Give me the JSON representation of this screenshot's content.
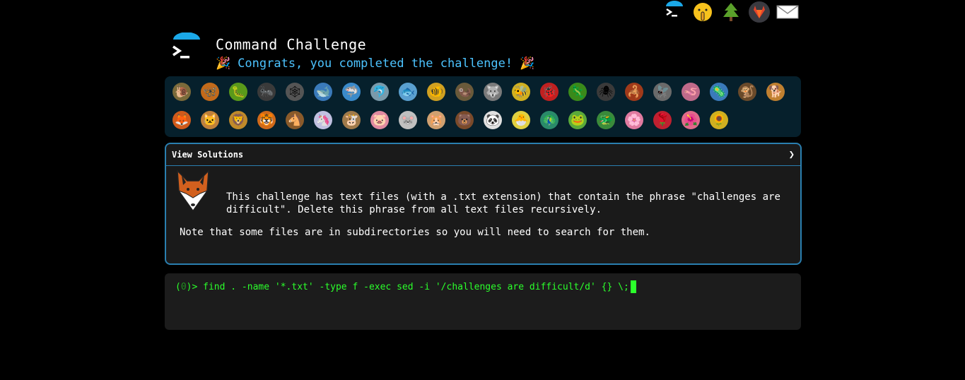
{
  "header": {
    "title": "Command Challenge",
    "subtitle": "Congrats, you completed the challenge!",
    "party_icon": "🎉"
  },
  "topnav": [
    {
      "name": "terminal-logo-icon"
    },
    {
      "name": "shush-face-icon",
      "glyph": "🤫"
    },
    {
      "name": "tree-icon",
      "glyph": "🌲"
    },
    {
      "name": "gitlab-icon"
    },
    {
      "name": "mail-icon",
      "glyph": "✉"
    }
  ],
  "challenges_row1": [
    {
      "name": "snail",
      "glyph": "🐌",
      "color": "#7a6a3a"
    },
    {
      "name": "butterfly",
      "glyph": "🦋",
      "color": "#c26a1a"
    },
    {
      "name": "caterpillar",
      "glyph": "🐛",
      "color": "#5a9a1a"
    },
    {
      "name": "ant",
      "glyph": "🐜",
      "color": "#3a3a3a"
    },
    {
      "name": "spider-web",
      "glyph": "🕸",
      "color": "#555"
    },
    {
      "name": "whale",
      "glyph": "🐋",
      "color": "#3a7aba"
    },
    {
      "name": "shark",
      "glyph": "🦈",
      "color": "#3a8aca"
    },
    {
      "name": "dolphin",
      "glyph": "🐬",
      "color": "#7a9aaa"
    },
    {
      "name": "fish",
      "glyph": "🐟",
      "color": "#5aa0d0"
    },
    {
      "name": "tropical-fish",
      "glyph": "🐠",
      "color": "#d0a020"
    },
    {
      "name": "otter",
      "glyph": "🦦",
      "color": "#6a5a3a"
    },
    {
      "name": "wolf",
      "glyph": "🐺",
      "color": "#7a7a7a"
    },
    {
      "name": "bee",
      "glyph": "🐝",
      "color": "#d0b020"
    },
    {
      "name": "ladybug",
      "glyph": "🐞",
      "color": "#c02020"
    },
    {
      "name": "lizard",
      "glyph": "🦎",
      "color": "#3a8a1a"
    },
    {
      "name": "spider",
      "glyph": "🕷",
      "color": "#3a3a3a"
    },
    {
      "name": "scorpion",
      "glyph": "🦂",
      "color": "#a03a1a"
    },
    {
      "name": "fly",
      "glyph": "🪰",
      "color": "#6a6a6a"
    },
    {
      "name": "worm",
      "glyph": "🪱",
      "color": "#c06a8a"
    },
    {
      "name": "microbe",
      "glyph": "🦠",
      "color": "#3a7aba"
    },
    {
      "name": "monkey",
      "glyph": "🐒",
      "color": "#6a4a2a"
    },
    {
      "name": "dog",
      "glyph": "🐕",
      "color": "#c08030"
    }
  ],
  "challenges_row2": [
    {
      "name": "fox",
      "glyph": "🦊",
      "color": "#d05a1a"
    },
    {
      "name": "cat",
      "glyph": "🐱",
      "color": "#c0803a"
    },
    {
      "name": "lion",
      "glyph": "🦁",
      "color": "#c08a2a"
    },
    {
      "name": "tiger",
      "glyph": "🐯",
      "color": "#d06a1a"
    },
    {
      "name": "horse",
      "glyph": "🐴",
      "color": "#8a5a2a"
    },
    {
      "name": "unicorn",
      "glyph": "🦄",
      "color": "#c0c0e0"
    },
    {
      "name": "cow",
      "glyph": "🐮",
      "color": "#a07a4a"
    },
    {
      "name": "pig",
      "glyph": "🐷",
      "color": "#e08aa0"
    },
    {
      "name": "mouse",
      "glyph": "🐭",
      "color": "#c0c0c0"
    },
    {
      "name": "hamster",
      "glyph": "🐹",
      "color": "#d0a070"
    },
    {
      "name": "bear",
      "glyph": "🐻",
      "color": "#7a4a2a"
    },
    {
      "name": "panda",
      "glyph": "🐼",
      "color": "#e0e0e0"
    },
    {
      "name": "hatching-chick",
      "glyph": "🐣",
      "color": "#e0d040"
    },
    {
      "name": "peacock",
      "glyph": "🦚",
      "color": "#2a8a6a"
    },
    {
      "name": "frog",
      "glyph": "🐸",
      "color": "#5aaa3a"
    },
    {
      "name": "dragon",
      "glyph": "🐲",
      "color": "#3a8a3a"
    },
    {
      "name": "cherry-blossom",
      "glyph": "🌸",
      "color": "#e07aa0"
    },
    {
      "name": "rose",
      "glyph": "🌹",
      "color": "#c02030"
    },
    {
      "name": "hibiscus",
      "glyph": "🌺",
      "color": "#e06a8a"
    },
    {
      "name": "sunflower",
      "glyph": "🌻",
      "color": "#d0b020"
    }
  ],
  "solutions": {
    "label": "View Solutions",
    "chevron": "❯"
  },
  "challenge": {
    "description": "This challenge has text files (with a .txt extension) that contain the phrase \"challenges are difficult\". Delete this phrase from all text files recursively.",
    "note": "Note that some files are in subdirectories so you will need to search for them."
  },
  "terminal": {
    "prompt_open": "(",
    "prompt_num": "0",
    "prompt_close": ")>",
    "command": " find . -name '*.txt' -type f -exec sed -i '/challenges are difficult/d' {} \\;"
  },
  "colors": {
    "accent": "#4cc3ff",
    "panel_border": "#2a7fb0",
    "terminal_green": "#2bff2b"
  }
}
